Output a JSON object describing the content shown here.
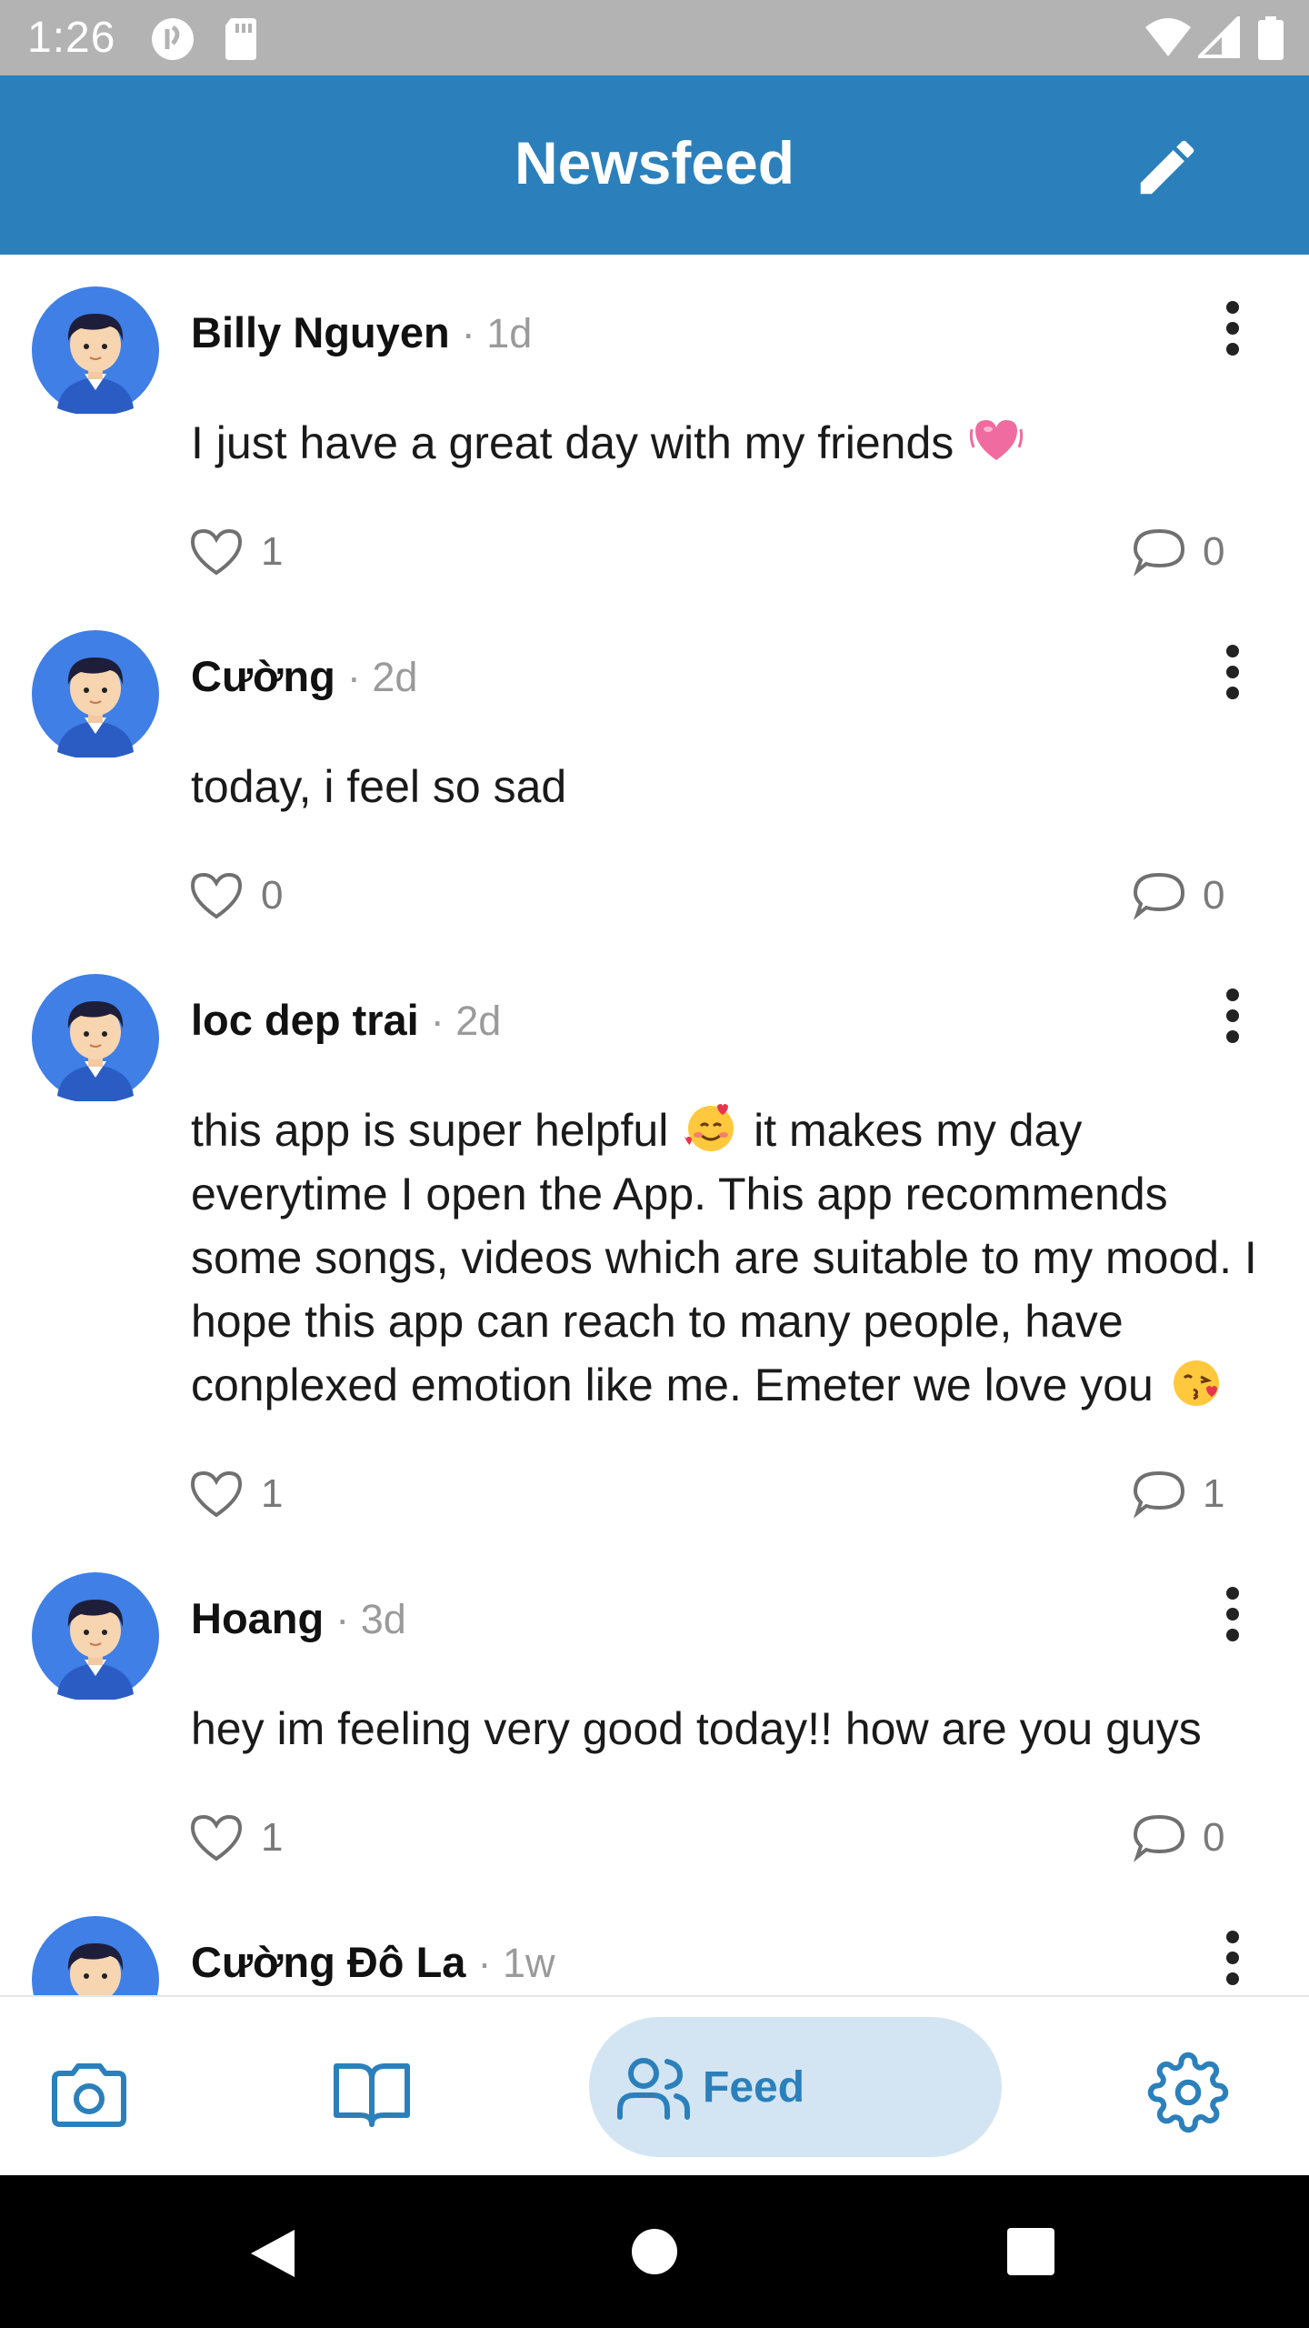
{
  "status_bar": {
    "time": "1:26"
  },
  "header": {
    "title": "Newsfeed",
    "edit_icon": "pencil-icon"
  },
  "posts": [
    {
      "author": "Billy Nguyen",
      "time": "· 1d",
      "lines": [
        "I just have a great day with my friends"
      ],
      "emoji": [
        "vibrating-heart-emoji"
      ],
      "likes": "1",
      "comments": "0"
    },
    {
      "author": "Cường",
      "time": "· 2d",
      "lines": [
        "today, i feel so sad"
      ],
      "likes": "0",
      "comments": "0"
    },
    {
      "author": "loc dep trai",
      "time": "· 2d",
      "lines": [
        "this app is super helpful",
        "it makes my day",
        "everytime I open the App. This app recommends",
        "some songs, videos which are suitable to my mood. I",
        "hope this app can reach to many people, have",
        "conplexed emotion like me. Emeter we love you"
      ],
      "emoji": [
        "smiling-face-with-hearts-emoji",
        "kissing-face-emoji"
      ],
      "likes": "1",
      "comments": "1"
    },
    {
      "author": "Hoang",
      "time": "· 3d",
      "lines": [
        "hey im feeling very good today!! how are you guys"
      ],
      "likes": "1",
      "comments": "0"
    },
    {
      "author": "Cường Đô La",
      "time": "· 1w"
    }
  ],
  "bottom_nav": {
    "items": [
      {
        "icon": "camera-icon"
      },
      {
        "icon": "book-icon"
      },
      {
        "icon": "people-icon",
        "label": "Feed",
        "active": true
      },
      {
        "icon": "gear-icon"
      }
    ]
  },
  "colors": {
    "primary": "#2b80bb",
    "active_pill": "#d3e5f3",
    "status_bar": "#b3b3b3"
  }
}
